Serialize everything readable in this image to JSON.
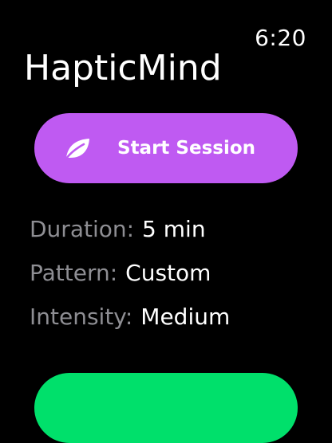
{
  "status_bar": {
    "time": "6:20"
  },
  "app": {
    "title": "HapticMind"
  },
  "start_button": {
    "label": "Start Session",
    "icon": "leaf-icon",
    "color": "#bf5af2"
  },
  "settings": [
    {
      "key": "Duration:",
      "value": "5 min"
    },
    {
      "key": "Pattern:",
      "value": "Custom"
    },
    {
      "key": "Intensity:",
      "value": "Medium"
    }
  ],
  "secondary_button": {
    "color": "#00e06b"
  },
  "colors": {
    "background": "#000000",
    "label_muted": "#8e8e93",
    "text": "#ffffff"
  }
}
